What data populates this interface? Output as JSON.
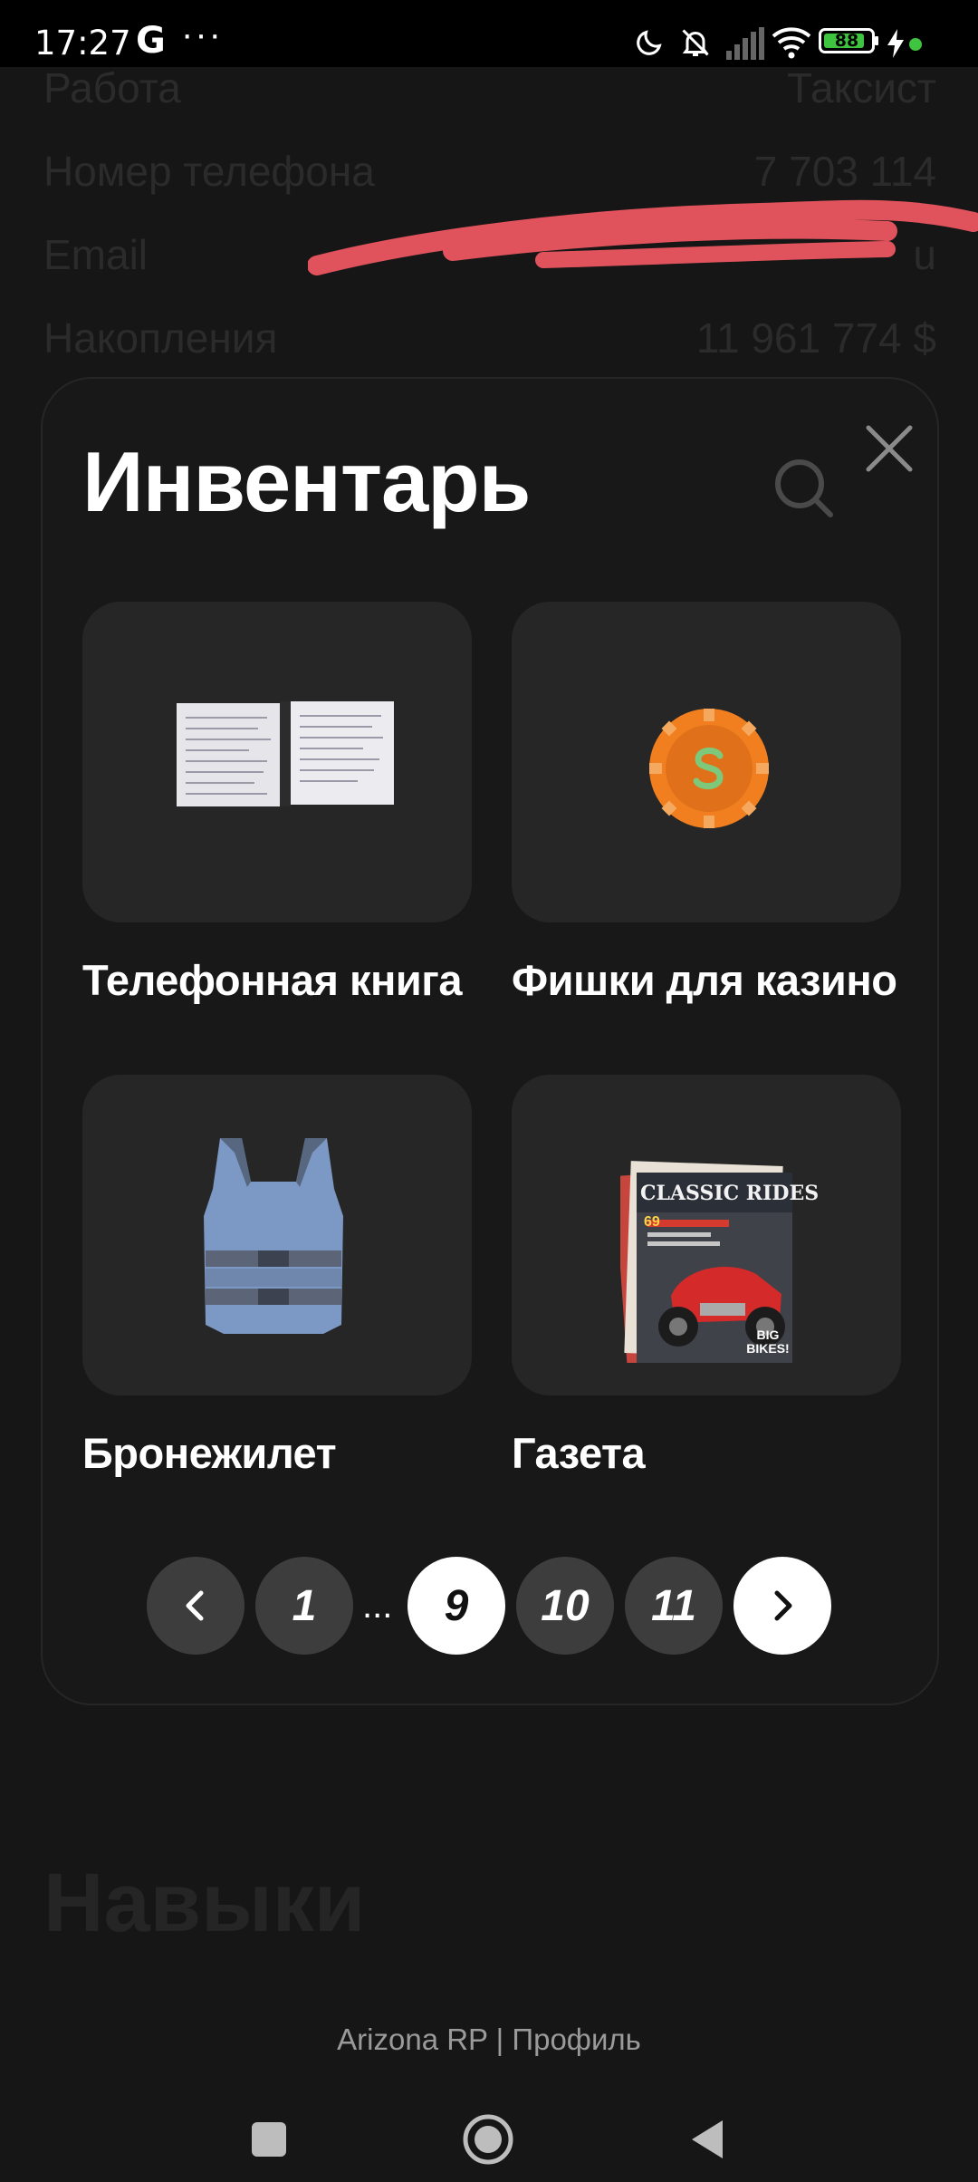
{
  "status_bar": {
    "time": "17:27",
    "g_icon": "G",
    "more": "···",
    "battery_level": "88",
    "battery_percent": 88,
    "icons": [
      "moon-icon",
      "bell-muted-icon",
      "signal-icon",
      "wifi-icon",
      "battery-icon",
      "charging-icon"
    ]
  },
  "profile_rows": [
    {
      "label": "Работа",
      "value": "Таксист"
    },
    {
      "label": "Номер телефона",
      "value": "7 703 114"
    },
    {
      "label": "Email",
      "value": "u"
    },
    {
      "label": "Накопления",
      "value": "11 961 774 $"
    }
  ],
  "modal": {
    "title": "Инвентарь",
    "items": [
      {
        "label": "Телефонная книга",
        "icon": "phonebook-icon"
      },
      {
        "label": "Фишки для казино",
        "icon": "casino-chip-icon"
      },
      {
        "label": "Бронежилет",
        "icon": "body-armor-icon"
      },
      {
        "label": "Газета",
        "icon": "newspaper-icon"
      }
    ],
    "newspaper_headline": "CLASSIC RIDES",
    "newspaper_badge": "BIG BIKES!",
    "newspaper_issue": "69"
  },
  "pagination": {
    "pages": [
      "1",
      "9",
      "10",
      "11"
    ],
    "ellipsis": "...",
    "current": "9"
  },
  "section_title": "Навыки",
  "caption": "Arizona RP | Профиль",
  "colors": {
    "background": "#161616",
    "card": "#262626",
    "accent_active": "#ffffff",
    "scribble": "#e0535c",
    "battery": "#3ec43e"
  }
}
